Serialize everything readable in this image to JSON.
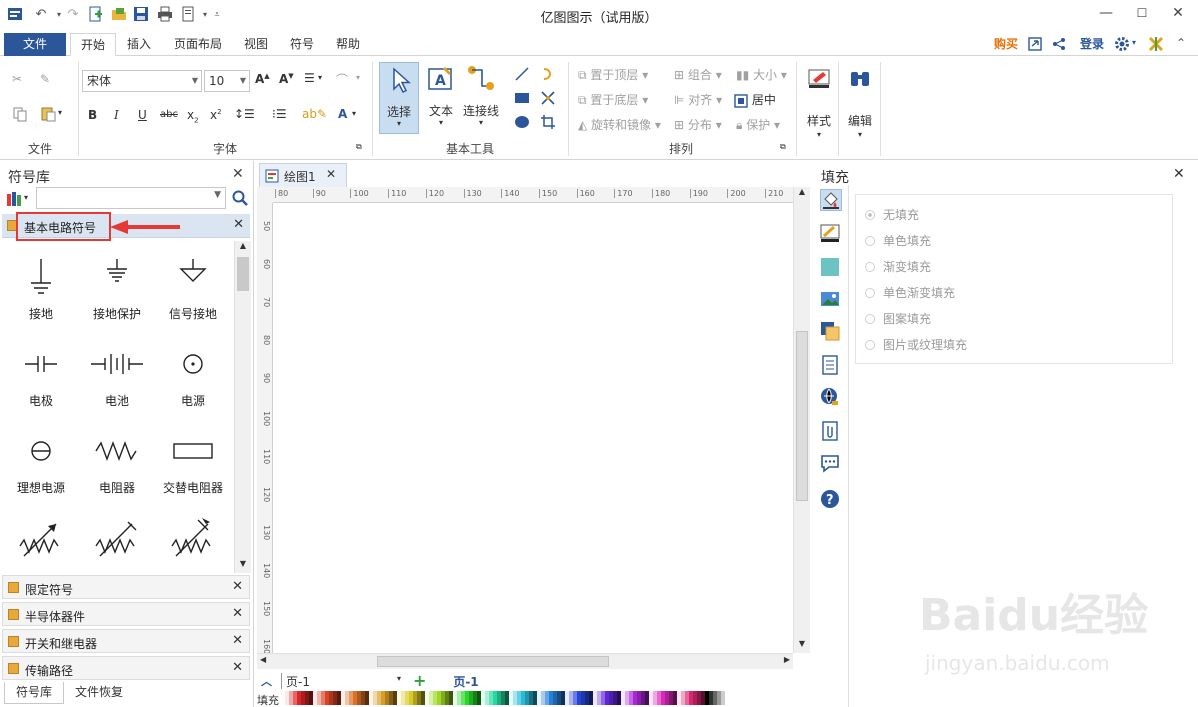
{
  "window": {
    "title": "亿图图示（试用版）",
    "min": "—",
    "max": "☐",
    "close": "✕"
  },
  "menu": {
    "file": "文件",
    "tabs": [
      "开始",
      "插入",
      "页面布局",
      "视图",
      "符号",
      "帮助"
    ],
    "buy": "购买",
    "login": "登录"
  },
  "ribbon": {
    "groups": {
      "file": "文件",
      "font": "字体",
      "tools": "基本工具",
      "arrange": "排列"
    },
    "font_name": "宋体",
    "font_size": "10",
    "tool_select": "选择",
    "tool_text": "文本",
    "tool_connector": "连接线",
    "arrange_items": [
      "置于顶层",
      "组合",
      "大小",
      "置于底层",
      "对齐",
      "居中",
      "旋转和镜像",
      "分布",
      "保护"
    ],
    "style": "样式",
    "edit": "编辑"
  },
  "symbols_panel": {
    "title": "符号库",
    "active_library": "基本电路符号",
    "items": [
      "接地",
      "接地保护",
      "信号接地",
      "电极",
      "电池",
      "电源",
      "理想电源",
      "电阻器",
      "交替电阻器"
    ],
    "other_libraries": [
      "限定符号",
      "半导体器件",
      "开关和继电器",
      "传输路径"
    ],
    "bottom_tabs": [
      "符号库",
      "文件恢复"
    ]
  },
  "canvas": {
    "doc_tab": "绘图1",
    "h_ticks": [
      "80",
      "90",
      "100",
      "110",
      "120",
      "130",
      "140",
      "150",
      "160",
      "170",
      "180",
      "190",
      "200",
      "210"
    ],
    "v_ticks": [
      "50",
      "60",
      "70",
      "80",
      "90",
      "100",
      "110",
      "120",
      "130",
      "140",
      "150",
      "160"
    ],
    "page_select": "页-1",
    "page_tab": "页-1",
    "fill_label": "填充"
  },
  "fill_panel": {
    "title": "填充",
    "options": [
      "无填充",
      "单色填充",
      "渐变填充",
      "单色渐变填充",
      "图案填充",
      "图片或纹理填充"
    ]
  },
  "watermark": {
    "brand": "Baidu经验",
    "url": "jingyan.baidu.com"
  },
  "colors": {
    "accent": "#2b579a",
    "highlight": "#e53935",
    "library_head": "#dbe5f1"
  }
}
